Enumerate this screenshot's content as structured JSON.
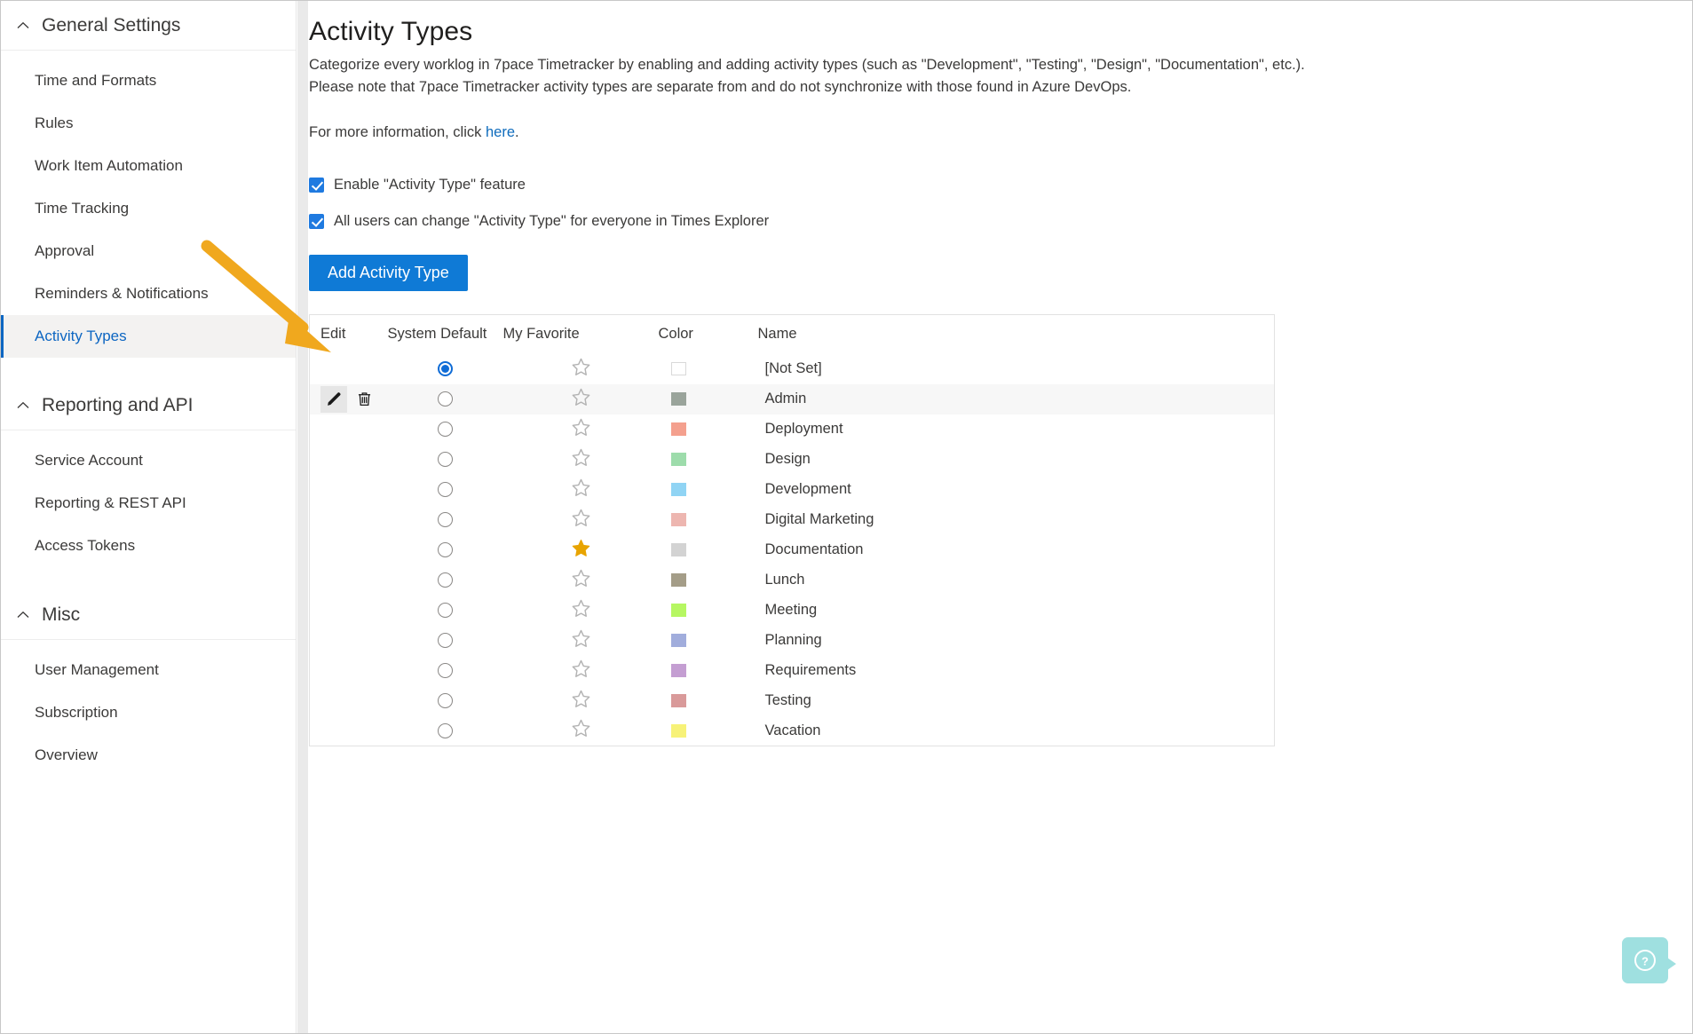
{
  "sidebar": {
    "groups": [
      {
        "title": "General Settings",
        "icon": "chevron-up-icon",
        "items": [
          {
            "label": "Time and Formats",
            "selected": false
          },
          {
            "label": "Rules",
            "selected": false
          },
          {
            "label": "Work Item Automation",
            "selected": false
          },
          {
            "label": "Time Tracking",
            "selected": false
          },
          {
            "label": "Approval",
            "selected": false
          },
          {
            "label": "Reminders & Notifications",
            "selected": false
          },
          {
            "label": "Activity Types",
            "selected": true
          }
        ]
      },
      {
        "title": "Reporting and API",
        "icon": "chevron-up-icon",
        "items": [
          {
            "label": "Service Account",
            "selected": false
          },
          {
            "label": "Reporting & REST API",
            "selected": false
          },
          {
            "label": "Access Tokens",
            "selected": false
          }
        ]
      },
      {
        "title": "Misc",
        "icon": "chevron-up-icon",
        "items": [
          {
            "label": "User Management",
            "selected": false
          },
          {
            "label": "Subscription",
            "selected": false
          },
          {
            "label": "Overview",
            "selected": false
          }
        ]
      }
    ]
  },
  "main": {
    "title": "Activity Types",
    "description_line1": "Categorize every worklog in 7pace Timetracker by enabling and adding activity types (such as \"Development\", \"Testing\", \"Design\", \"Documentation\", etc.).",
    "description_line2": "Please note that 7pace Timetracker activity types are separate from and do not synchronize with those found in Azure DevOps.",
    "more_info_prefix": "For more information, click ",
    "more_info_link": "here",
    "more_info_suffix": ".",
    "checkboxes": [
      {
        "label": "Enable \"Activity Type\" feature",
        "checked": true
      },
      {
        "label": "All users can change \"Activity Type\" for everyone in Times Explorer",
        "checked": true
      }
    ],
    "add_button_label": "Add Activity Type",
    "table": {
      "columns": [
        "Edit",
        "System Default",
        "My Favorite",
        "Color",
        "Name"
      ],
      "rows": [
        {
          "name": "[Not Set]",
          "system_default": true,
          "favorite": false,
          "color": "",
          "color_empty": true,
          "edit_icons": false,
          "hover": false
        },
        {
          "name": "Admin",
          "system_default": false,
          "favorite": false,
          "color": "#9aa49b",
          "color_empty": false,
          "edit_icons": true,
          "hover": true
        },
        {
          "name": "Deployment",
          "system_default": false,
          "favorite": false,
          "color": "#f4a08e",
          "color_empty": false,
          "edit_icons": false,
          "hover": false
        },
        {
          "name": "Design",
          "system_default": false,
          "favorite": false,
          "color": "#9ddcab",
          "color_empty": false,
          "edit_icons": false,
          "hover": false
        },
        {
          "name": "Development",
          "system_default": false,
          "favorite": false,
          "color": "#90d4f4",
          "color_empty": false,
          "edit_icons": false,
          "hover": false
        },
        {
          "name": "Digital Marketing",
          "system_default": false,
          "favorite": false,
          "color": "#edb6b0",
          "color_empty": false,
          "edit_icons": false,
          "hover": false
        },
        {
          "name": "Documentation",
          "system_default": false,
          "favorite": true,
          "color": "#d3d3d3",
          "color_empty": false,
          "edit_icons": false,
          "hover": false
        },
        {
          "name": "Lunch",
          "system_default": false,
          "favorite": false,
          "color": "#a49d88",
          "color_empty": false,
          "edit_icons": false,
          "hover": false
        },
        {
          "name": "Meeting",
          "system_default": false,
          "favorite": false,
          "color": "#b6f762",
          "color_empty": false,
          "edit_icons": false,
          "hover": false
        },
        {
          "name": "Planning",
          "system_default": false,
          "favorite": false,
          "color": "#a1addc",
          "color_empty": false,
          "edit_icons": false,
          "hover": false
        },
        {
          "name": "Requirements",
          "system_default": false,
          "favorite": false,
          "color": "#c49ed2",
          "color_empty": false,
          "edit_icons": false,
          "hover": false
        },
        {
          "name": "Testing",
          "system_default": false,
          "favorite": false,
          "color": "#d99a9a",
          "color_empty": false,
          "edit_icons": false,
          "hover": false
        },
        {
          "name": "Vacation",
          "system_default": false,
          "favorite": false,
          "color": "#f7f278",
          "color_empty": false,
          "edit_icons": false,
          "hover": false
        }
      ]
    }
  },
  "annotation": {
    "arrow_color": "#f0a81e",
    "points_to": "edit-pencil-icon"
  },
  "help": {
    "icon": "question-mark-icon",
    "color": "#9fe0e0"
  },
  "colors": {
    "accent_blue": "#0f7ad6",
    "link_blue": "#0f6cbd",
    "selected_nav": "#0d66c2",
    "star_active": "#e8a400",
    "star_inactive": "#b3b3b3",
    "row_hover": "#f7f7f7"
  }
}
